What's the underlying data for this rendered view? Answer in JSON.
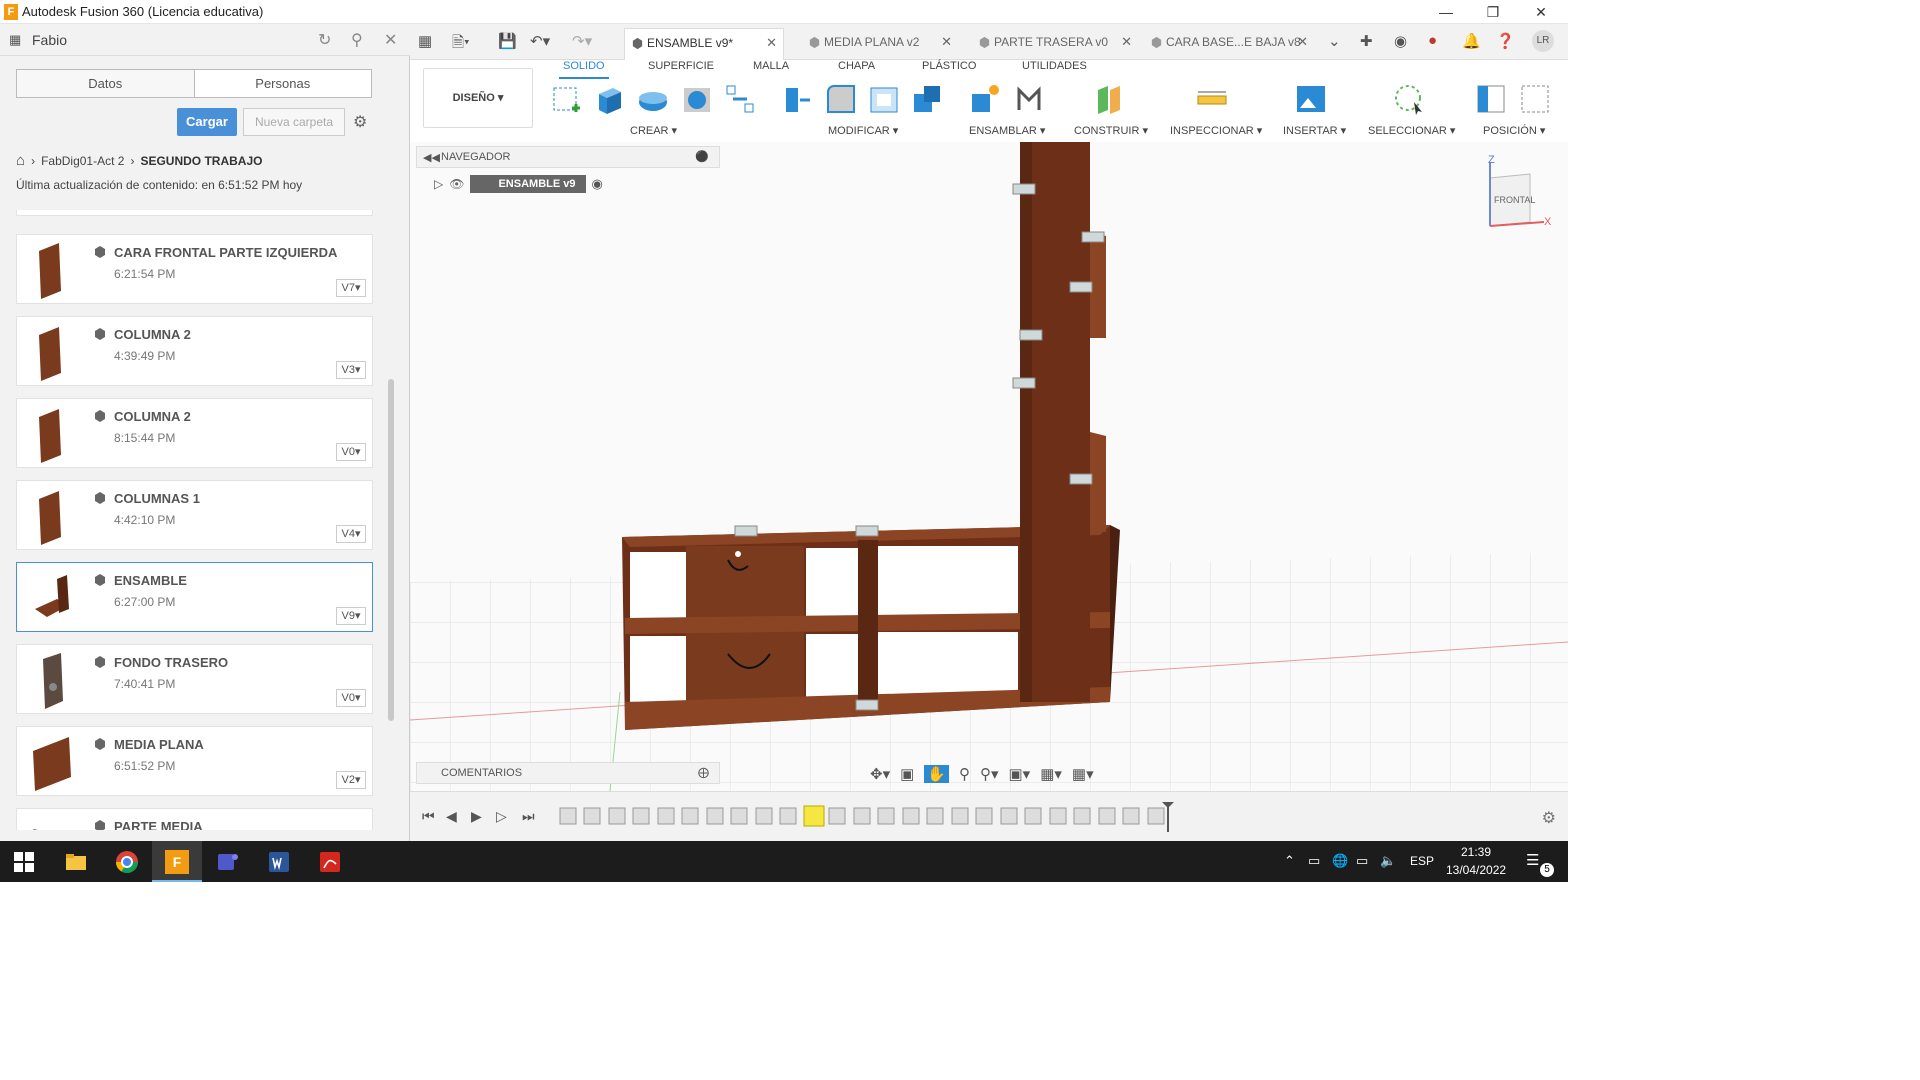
{
  "window": {
    "title": "Autodesk Fusion 360 (Licencia educativa)",
    "app_icon": "F"
  },
  "data_panel": {
    "user": "Fabio",
    "tabs": [
      "Datos",
      "Personas"
    ],
    "upload_label": "Cargar",
    "new_folder_label": "Nueva carpeta",
    "breadcrumb": [
      "FabDig01-Act 2",
      "SEGUNDO TRABAJO"
    ],
    "last_update": "Última actualización de contenido: en 6:51:52 PM hoy",
    "files": [
      {
        "name": "CARA FRONTAL PARTE IZQUIERDA",
        "time": "6:21:54 PM",
        "version": "V7"
      },
      {
        "name": "COLUMNA 2",
        "time": "4:39:49 PM",
        "version": "V3"
      },
      {
        "name": "COLUMNA 2",
        "time": "8:15:44 PM",
        "version": "V0"
      },
      {
        "name": "COLUMNAS 1",
        "time": "4:42:10 PM",
        "version": "V4"
      },
      {
        "name": "ENSAMBLE",
        "time": "6:27:00 PM",
        "version": "V9"
      },
      {
        "name": "FONDO TRASERO",
        "time": "7:40:41 PM",
        "version": "V0"
      },
      {
        "name": "MEDIA PLANA",
        "time": "6:51:52 PM",
        "version": "V2"
      },
      {
        "name": "PARTE MEDIA",
        "time": "",
        "version": ""
      }
    ]
  },
  "doc_tabs": [
    {
      "label": "ENSAMBLE v9*",
      "active": true
    },
    {
      "label": "MEDIA PLANA v2",
      "active": false
    },
    {
      "label": "PARTE TRASERA v0",
      "active": false
    },
    {
      "label": "CARA BASE...E BAJA v8",
      "active": false
    }
  ],
  "user_initials": "LR",
  "toolbar": {
    "workspace": "DISEÑO ▾",
    "tabs": [
      "SOLIDO",
      "SUPERFICIE",
      "MALLA",
      "CHAPA",
      "PLÁSTICO",
      "UTILIDADES"
    ],
    "groups": [
      "CREAR ▾",
      "MODIFICAR ▾",
      "ENSAMBLAR ▾",
      "CONSTRUIR ▾",
      "INSPECCIONAR ▾",
      "INSERTAR ▾",
      "SELECCIONAR ▾",
      "POSICIÓN ▾"
    ]
  },
  "browser": {
    "title": "NAVEGADOR",
    "root": "ENSAMBLE v9",
    "comments": "COMENTARIOS"
  },
  "viewcube": {
    "face": "FRONTAL",
    "axis_z": "Z",
    "axis_x": "X"
  },
  "taskbar": {
    "lang": "ESP",
    "time": "21:39",
    "date": "13/04/2022",
    "notif_count": "5"
  },
  "colors": {
    "accent": "#2a8ad4",
    "wood": "#7a3a1e",
    "wood_dark": "#5a2812",
    "upload_btn": "#4a90d9"
  }
}
